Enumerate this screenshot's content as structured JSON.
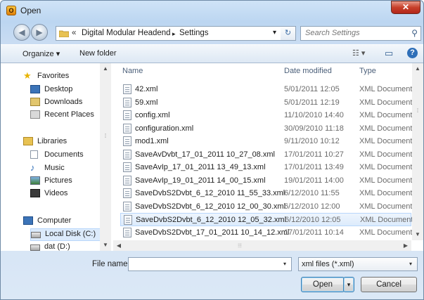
{
  "window": {
    "title": "Open",
    "close_glyph": "✕"
  },
  "nav": {
    "back_glyph": "◀",
    "forward_glyph": "▶",
    "breadcrumb_prefix": "«",
    "path": [
      "Digital Modular Headend",
      "Settings"
    ],
    "separator": "▸",
    "dropdown_glyph": "▾",
    "refresh_glyph": "↻",
    "search_placeholder": "Search Settings",
    "search_glyph": "⚲"
  },
  "toolbar": {
    "organize_label": "Organize ▾",
    "new_folder_label": "New folder",
    "views_glyph": "☷ ▾",
    "preview_glyph": "▭",
    "help_glyph": "?"
  },
  "sidebar": {
    "favorites_label": "Favorites",
    "favorites": [
      "Desktop",
      "Downloads",
      "Recent Places"
    ],
    "libraries_label": "Libraries",
    "libraries": [
      "Documents",
      "Music",
      "Pictures",
      "Videos"
    ],
    "computer_label": "Computer",
    "drives": [
      "Local Disk (C:)",
      "dat (D:)"
    ]
  },
  "columns": {
    "name": "Name",
    "date": "Date modified",
    "type": "Type"
  },
  "files": [
    {
      "name": "42.xml",
      "date": "5/01/2011 12:05",
      "type": "XML Document"
    },
    {
      "name": "59.xml",
      "date": "5/01/2011 12:19",
      "type": "XML Document"
    },
    {
      "name": "config.xml",
      "date": "11/10/2010 14:40",
      "type": "XML Document"
    },
    {
      "name": "configuration.xml",
      "date": "30/09/2010 11:18",
      "type": "XML Document"
    },
    {
      "name": "mod1.xml",
      "date": "9/11/2010 10:12",
      "type": "XML Document"
    },
    {
      "name": "SaveAvDvbt_17_01_2011 10_27_08.xml",
      "date": "17/01/2011 10:27",
      "type": "XML Document"
    },
    {
      "name": "SaveAvIp_17_01_2011 13_49_13.xml",
      "date": "17/01/2011 13:49",
      "type": "XML Document"
    },
    {
      "name": "SaveAvIp_19_01_2011 14_00_15.xml",
      "date": "19/01/2011 14:00",
      "type": "XML Document"
    },
    {
      "name": "SaveDvbS2Dvbt_6_12_2010 11_55_33.xml",
      "date": "6/12/2010 11:55",
      "type": "XML Document"
    },
    {
      "name": "SaveDvbS2Dvbt_6_12_2010 12_00_30.xml",
      "date": "6/12/2010 12:00",
      "type": "XML Document"
    },
    {
      "name": "SaveDvbS2Dvbt_6_12_2010 12_05_32.xml",
      "date": "6/12/2010 12:05",
      "type": "XML Document",
      "selected": true
    },
    {
      "name": "SaveDvbS2Dvbt_17_01_2011 10_14_12.xml",
      "date": "17/01/2011 10:14",
      "type": "XML Document"
    }
  ],
  "scroll": {
    "up": "▲",
    "down": "▼",
    "left": "◀",
    "right": "▶",
    "grip": "⁞",
    "hgrip": "⦙⦙⦙"
  },
  "footer": {
    "file_name_label": "File name:",
    "file_name_value": "",
    "filter_value": "xml files (*.xml)",
    "open_label": "Open",
    "cancel_label": "Cancel",
    "split_arrow": "▾"
  },
  "colors": {
    "title_bg": "#c7dcf3",
    "selection": "#dcebfc",
    "close": "#c7402a"
  }
}
